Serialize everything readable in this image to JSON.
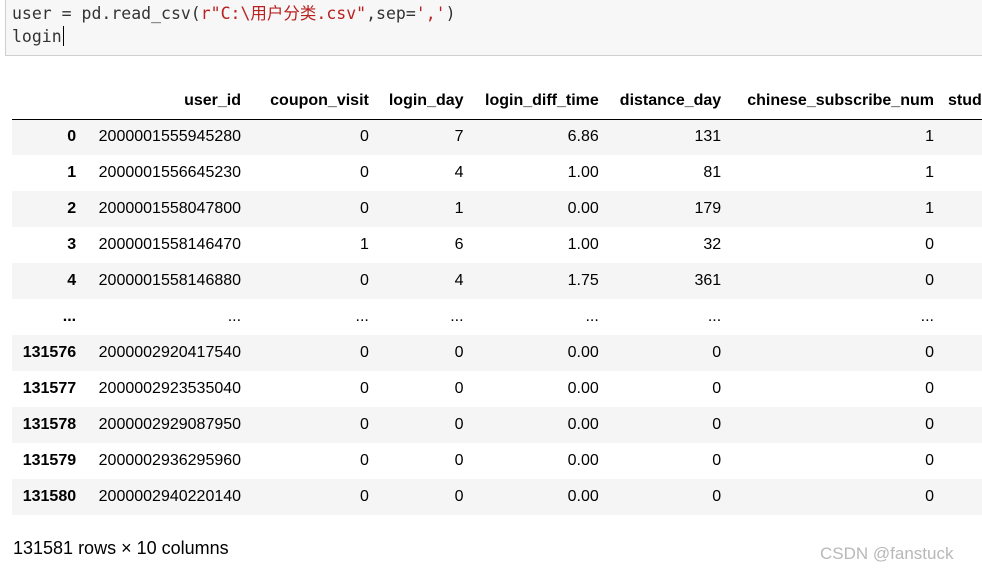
{
  "code": {
    "line1": {
      "part1": "user = pd.read_csv(",
      "part2": "r\"C:\\用户分类.csv\"",
      "part3": ",sep=",
      "part4": "','",
      "part5": ")"
    },
    "line2": "login"
  },
  "table": {
    "columns": [
      "",
      "user_id",
      "coupon_visit",
      "login_day",
      "login_diff_time",
      "distance_day",
      "chinese_subscribe_num",
      "stud"
    ],
    "rows": [
      {
        "index": "0",
        "cells": [
          "2000001555945280",
          "0",
          "7",
          "6.86",
          "131",
          "1"
        ]
      },
      {
        "index": "1",
        "cells": [
          "2000001556645230",
          "0",
          "4",
          "1.00",
          "81",
          "1"
        ]
      },
      {
        "index": "2",
        "cells": [
          "2000001558047800",
          "0",
          "1",
          "0.00",
          "179",
          "1"
        ]
      },
      {
        "index": "3",
        "cells": [
          "2000001558146470",
          "1",
          "6",
          "1.00",
          "32",
          "0"
        ]
      },
      {
        "index": "4",
        "cells": [
          "2000001558146880",
          "0",
          "4",
          "1.75",
          "361",
          "0"
        ]
      },
      {
        "index": "...",
        "cells": [
          "...",
          "...",
          "...",
          "...",
          "...",
          "..."
        ]
      },
      {
        "index": "131576",
        "cells": [
          "2000002920417540",
          "0",
          "0",
          "0.00",
          "0",
          "0"
        ]
      },
      {
        "index": "131577",
        "cells": [
          "2000002923535040",
          "0",
          "0",
          "0.00",
          "0",
          "0"
        ]
      },
      {
        "index": "131578",
        "cells": [
          "2000002929087950",
          "0",
          "0",
          "0.00",
          "0",
          "0"
        ]
      },
      {
        "index": "131579",
        "cells": [
          "2000002936295960",
          "0",
          "0",
          "0.00",
          "0",
          "0"
        ]
      },
      {
        "index": "131580",
        "cells": [
          "2000002940220140",
          "0",
          "0",
          "0.00",
          "0",
          "0"
        ]
      }
    ]
  },
  "shape_text": "131581 rows × 10 columns",
  "watermark": "CSDN @fanstuck"
}
